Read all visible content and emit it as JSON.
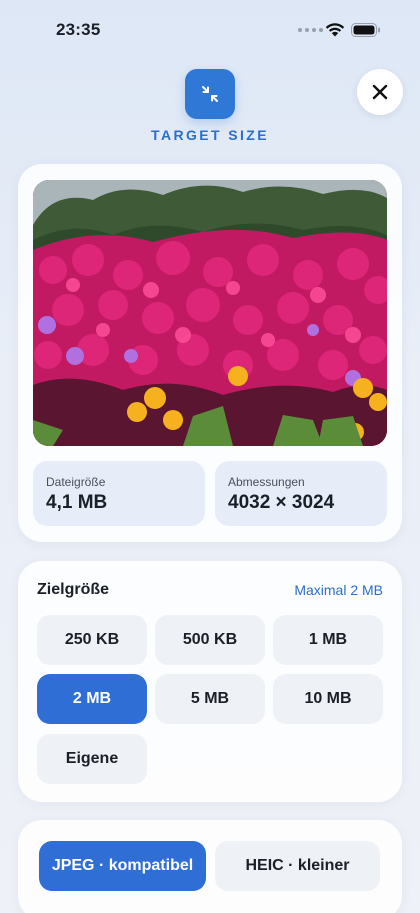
{
  "status": {
    "time": "23:35"
  },
  "header": {
    "title": "TARGET SIZE"
  },
  "image_info": {
    "file_size_label": "Dateigröße",
    "file_size_value": "4,1 MB",
    "dimensions_label": "Abmessungen",
    "dimensions_value": "4032 × 3024"
  },
  "target_size": {
    "title": "Zielgröße",
    "hint": "Maximal 2 MB",
    "options": [
      "250 KB",
      "500 KB",
      "1 MB",
      "2 MB",
      "5 MB",
      "10 MB",
      "Eigene"
    ],
    "selected": "2 MB"
  },
  "format": {
    "options": [
      "JPEG · kompatibel",
      "HEIC · kleiner"
    ],
    "selected": "JPEG · kompatibel"
  },
  "colors": {
    "accent": "#2f6fd5",
    "title": "#2a6fc9"
  }
}
